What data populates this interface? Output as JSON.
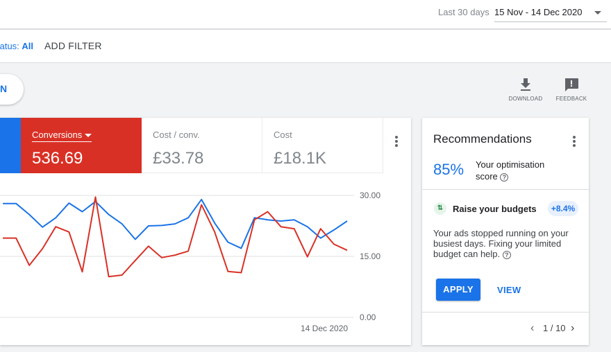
{
  "header": {
    "range_label": "Last 30 days",
    "range_value": "15 Nov - 14 Dec 2020"
  },
  "filters": {
    "status_label": "tatus:",
    "status_value": "All",
    "add_filter": "ADD FILTER"
  },
  "toolbar": {
    "pill_text": "N",
    "download_label": "DOWNLOAD",
    "feedback_label": "FEEDBACK"
  },
  "metrics": [
    {
      "label": "Conversions",
      "value": "536.69",
      "selected": true,
      "color": "#d93025"
    },
    {
      "label": "Cost / conv.",
      "value": "£33.78",
      "selected": false
    },
    {
      "label": "Cost",
      "value": "£18.1K",
      "selected": false
    }
  ],
  "chart_data": {
    "type": "line",
    "y_ticks": [
      "30.00",
      "15.00",
      "0.00"
    ],
    "ylim": [
      0,
      30
    ],
    "x_label": "14 Dec 2020",
    "series": [
      {
        "color": "#1a73e8",
        "values": [
          28.0,
          28.0,
          25.3,
          22.2,
          24.5,
          28.1,
          26.0,
          28.5,
          25.3,
          23.0,
          19.2,
          22.5,
          22.6,
          23.0,
          24.5,
          29.0,
          23.2,
          18.5,
          17.0,
          24.5,
          24.0,
          23.7,
          24.0,
          22.3,
          19.5,
          21.5,
          23.7
        ]
      },
      {
        "color": "#d93025",
        "values": [
          19.5,
          19.5,
          12.8,
          16.9,
          22.3,
          21.0,
          11.2,
          29.6,
          10.0,
          10.4,
          14.0,
          17.5,
          14.7,
          15.3,
          16.3,
          27.7,
          21.0,
          11.3,
          11.0,
          24.0,
          26.0,
          22.3,
          21.8,
          14.9,
          21.8,
          18.0,
          16.5
        ]
      }
    ]
  },
  "recommendations": {
    "title": "Recommendations",
    "score": "85%",
    "score_label": "Your optimisation score",
    "item_title": "Raise your budgets",
    "item_badge": "+8.4%",
    "item_body": "Your ads stopped running on your busiest days. Fixing your limited budget can help.",
    "apply_label": "APPLY",
    "view_label": "VIEW",
    "pager": "1 / 10"
  }
}
